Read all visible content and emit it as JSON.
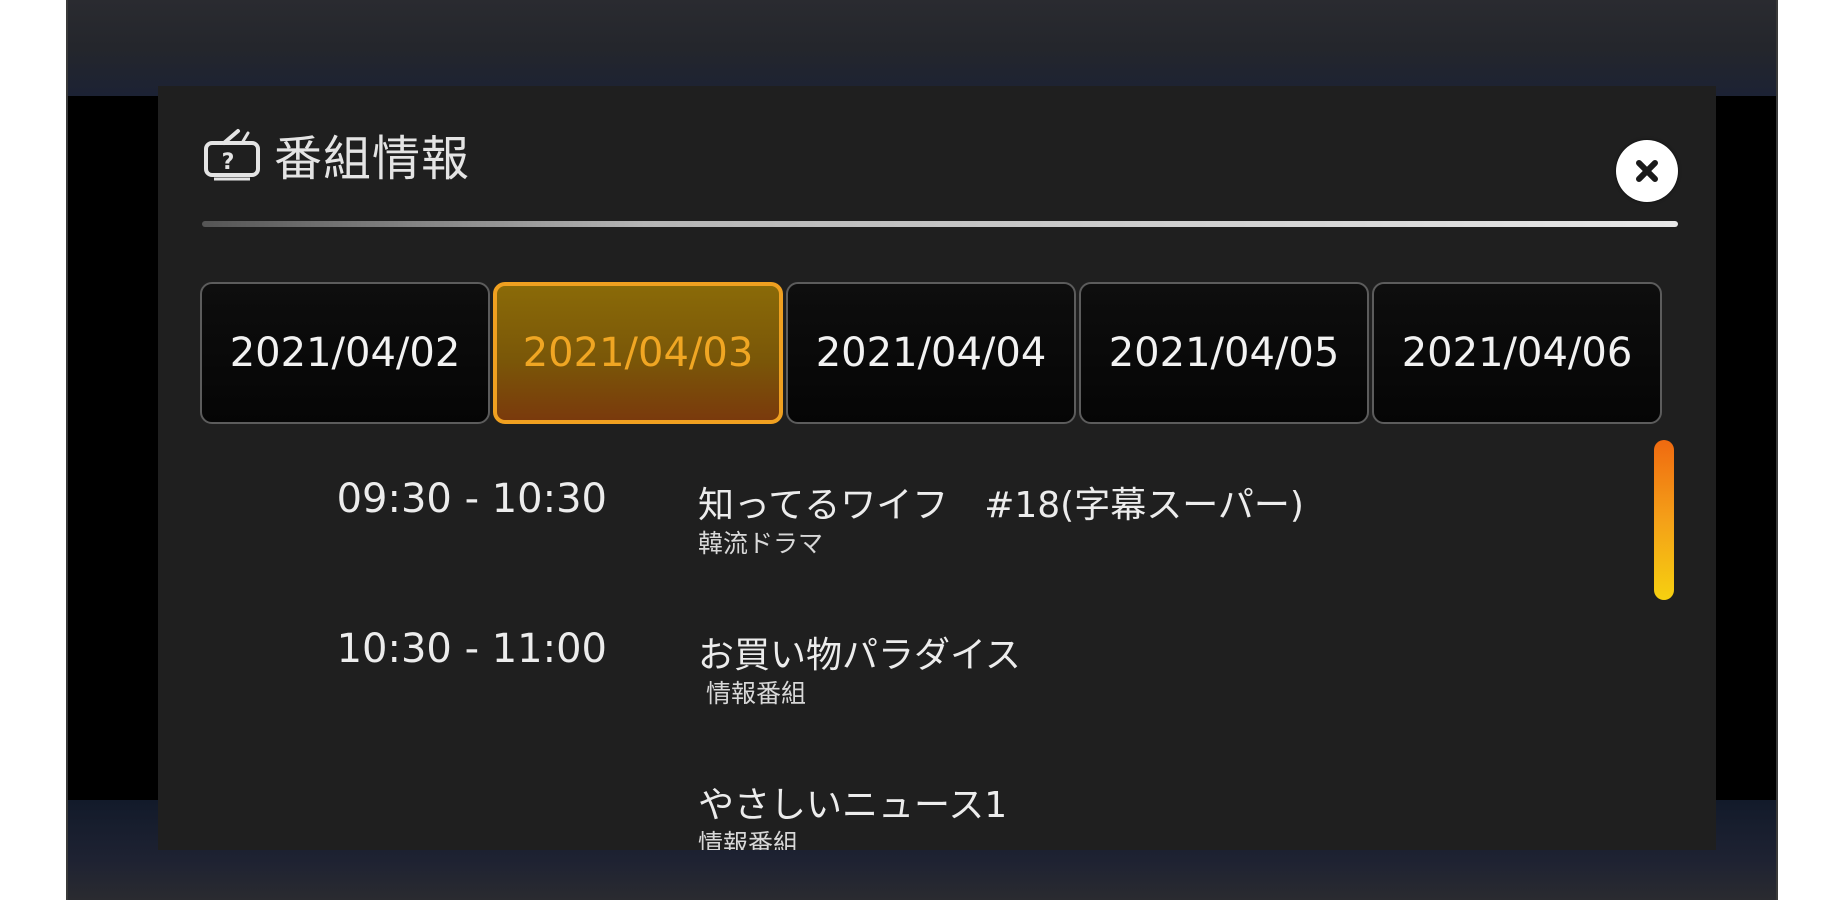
{
  "dialog": {
    "title": "番組情報",
    "icon": "tv-question-icon",
    "close_icon": "close-icon"
  },
  "tabs": [
    {
      "label": "2021/04/02",
      "selected": false
    },
    {
      "label": "2021/04/03",
      "selected": true
    },
    {
      "label": "2021/04/04",
      "selected": false
    },
    {
      "label": "2021/04/05",
      "selected": false
    },
    {
      "label": "2021/04/06",
      "selected": false
    }
  ],
  "programs": [
    {
      "time": "09:30 - 10:30",
      "title": "知ってるワイフ　#18(字幕スーパー)",
      "genre": "韓流ドラマ"
    },
    {
      "time": "10:30 - 11:00",
      "title": "お買い物パラダイス",
      "genre": "情報番組"
    },
    {
      "time": "",
      "title": "やさしいニュース1",
      "genre": "情報番組"
    }
  ],
  "colors": {
    "accent": "#f0a623",
    "panel_bg": "#1f1f1f",
    "text": "#ececec"
  }
}
